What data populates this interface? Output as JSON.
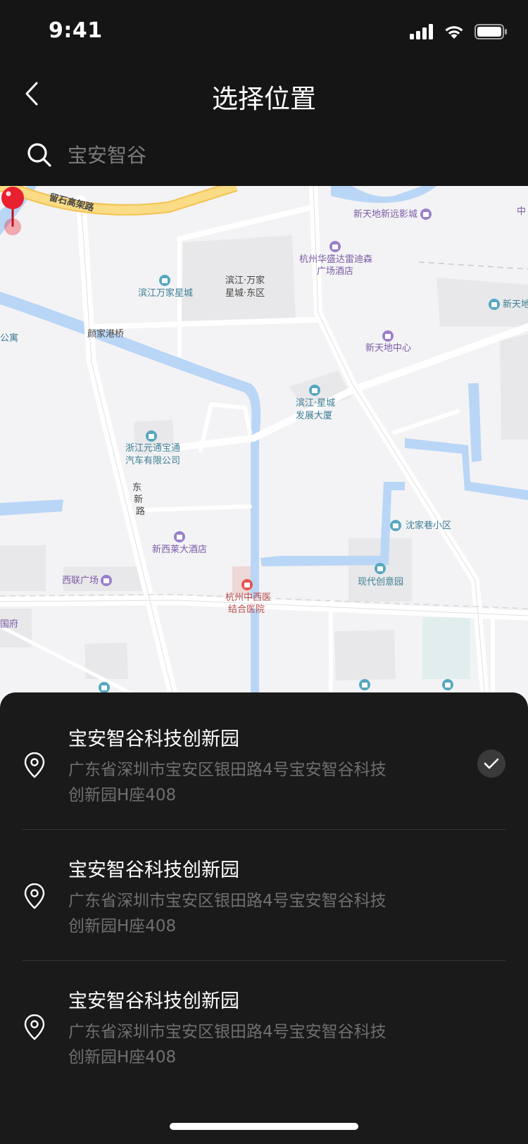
{
  "status_bar": {
    "time": "9:41",
    "icons": [
      "signal-icon",
      "wifi-icon",
      "battery-icon"
    ]
  },
  "nav": {
    "title": "选择位置",
    "back_icon": "chevron-left-icon"
  },
  "search": {
    "placeholder": "宝安智谷",
    "value": "",
    "icon": "search-icon"
  },
  "map": {
    "labels": {
      "road_liushi": "留石高架路",
      "xintiandi_cinema": "新天地新远影城",
      "zhong_cut": "中",
      "huasheng_hotel_1": "杭州华盛达雷迪森",
      "huasheng_hotel_2": "广场酒店",
      "binjiang_wanjia_1": "滨江·万家",
      "binjiang_wanjia_2": "星城·东区",
      "binjiang_wanjia_star": "滨江万家星城",
      "xintiandi_cut": "新天地",
      "gongyu_cut": "公寓",
      "yanjia_bridge": "颜家港桥",
      "xintiandi_center": "新天地中心",
      "binjiang_star_1": "滨江·星城",
      "binjiang_star_2": "发展大厦",
      "zhejiang_auto_1": "浙江元通宝通",
      "zhejiang_auto_2": "汽车有限公司",
      "dongxin_road_1": "东",
      "dongxin_road_2": "新",
      "dongxin_road_3": "路",
      "shenjia_xiang": "沈家巷小区",
      "xinxilai_hotel": "新西莱大酒店",
      "xilian_plaza": "西联广场",
      "modern_park": "现代创意园",
      "hospital_1": "杭州中西医",
      "hospital_2": "结合医院",
      "fu_cut": "国府"
    },
    "colors": {
      "land": "#f3f3f5",
      "road": "#ffffff",
      "highway": "#f9d77e",
      "water": "#b9d6f6",
      "block": "#e8e8ea",
      "pin": "#e8202f"
    }
  },
  "results": [
    {
      "name": "宝安智谷科技创新园",
      "address": "广东省深圳市宝安区银田路4号宝安智谷科技创新园H座408",
      "selected": true
    },
    {
      "name": "宝安智谷科技创新园",
      "address": "广东省深圳市宝安区银田路4号宝安智谷科技创新园H座408",
      "selected": false
    },
    {
      "name": "宝安智谷科技创新园",
      "address": "广东省深圳市宝安区银田路4号宝安智谷科技创新园H座408",
      "selected": false
    }
  ]
}
